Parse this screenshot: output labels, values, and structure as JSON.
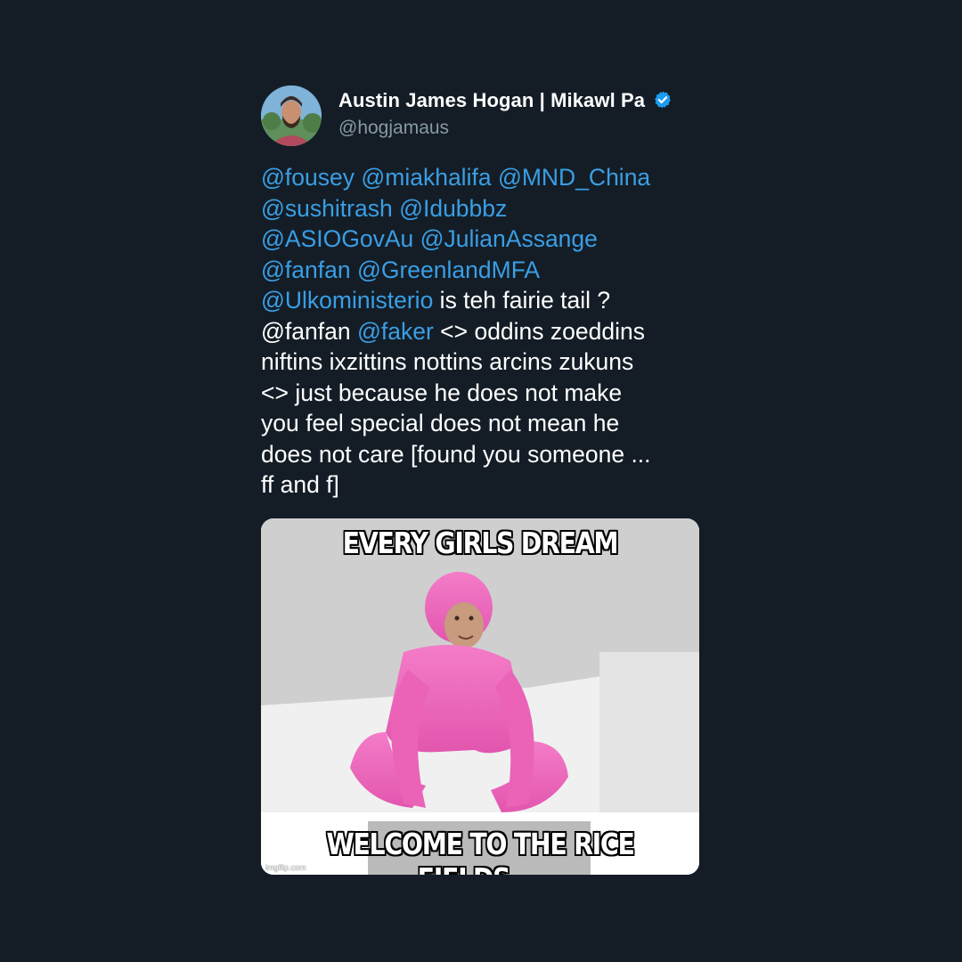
{
  "tweet": {
    "display_name": "Austin James Hogan | Mikawl Pa",
    "handle": "@hogjamaus",
    "verified": true,
    "text_segments": [
      {
        "text": "@fousey",
        "mention": true
      },
      {
        "text": " ",
        "mention": false
      },
      {
        "text": "@miakhalifa",
        "mention": true
      },
      {
        "text": " ",
        "mention": false
      },
      {
        "text": "@MND_China",
        "mention": true
      },
      {
        "text": "\n",
        "mention": false
      },
      {
        "text": "@sushitrash",
        "mention": true
      },
      {
        "text": " ",
        "mention": false
      },
      {
        "text": "@Idubbbz",
        "mention": true
      },
      {
        "text": "\n",
        "mention": false
      },
      {
        "text": "@ASIOGovAu",
        "mention": true
      },
      {
        "text": " ",
        "mention": false
      },
      {
        "text": "@JulianAssange",
        "mention": true
      },
      {
        "text": "\n",
        "mention": false
      },
      {
        "text": "@fanfan",
        "mention": true
      },
      {
        "text": " ",
        "mention": false
      },
      {
        "text": "@GreenlandMFA",
        "mention": true
      },
      {
        "text": "\n",
        "mention": false
      },
      {
        "text": "@Ulkoministerio",
        "mention": true
      },
      {
        "text": " is teh fairie tail ?\n@fanfan ",
        "mention": false
      },
      {
        "text": "@faker",
        "mention": true
      },
      {
        "text": " <> oddins zoeddins\nniftins ixzittins nottins arcins zukuns\n<> just because he does not make\nyou feel special does not mean he\ndoes not care [found you someone ...\nff and f]",
        "mention": false
      }
    ],
    "media": {
      "caption_top": "EVERY GIRLS DREAM",
      "caption_bottom": "WELCOME TO THE RICE FIELDS ...",
      "watermark": "imgflip.com"
    }
  },
  "colors": {
    "background": "#141d26",
    "mention": "#3a9ee4",
    "text": "#ffffff",
    "handle": "#8899a6",
    "verified": "#1d9bf0",
    "suit": "#f06ec0"
  }
}
